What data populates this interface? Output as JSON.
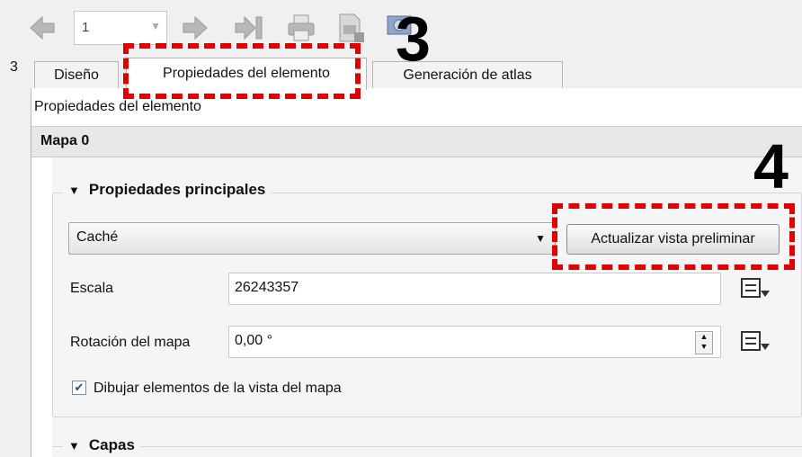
{
  "toolbar": {
    "page_value": "1",
    "icons": [
      "back-arrow-icon",
      "page-combo-dropdown",
      "forward-arrow-icon",
      "last-page-icon",
      "print-icon",
      "export-image-icon",
      "export-svg-icon"
    ]
  },
  "left_strip": {
    "number": "3"
  },
  "tabs": [
    {
      "label": "Diseño",
      "active": false
    },
    {
      "label": "Propiedades del elemento",
      "active": true
    },
    {
      "label": "Generación de atlas",
      "active": false
    }
  ],
  "panel": {
    "title": "Propiedades del elemento",
    "item_name": "Mapa 0"
  },
  "main_properties": {
    "title": "Propiedades principales",
    "cache_mode": "Caché",
    "refresh_label": "Actualizar vista preliminar",
    "scale_label": "Escala",
    "scale_value": "26243357",
    "rotation_label": "Rotación del mapa",
    "rotation_value": "0,00 °",
    "draw_items_label": "Dibujar elementos de la vista del mapa",
    "draw_items_checked": true
  },
  "layers_group": {
    "title": "Capas"
  },
  "annotations": {
    "step3": "3",
    "step4": "4",
    "highlight_color": "#e00000"
  }
}
